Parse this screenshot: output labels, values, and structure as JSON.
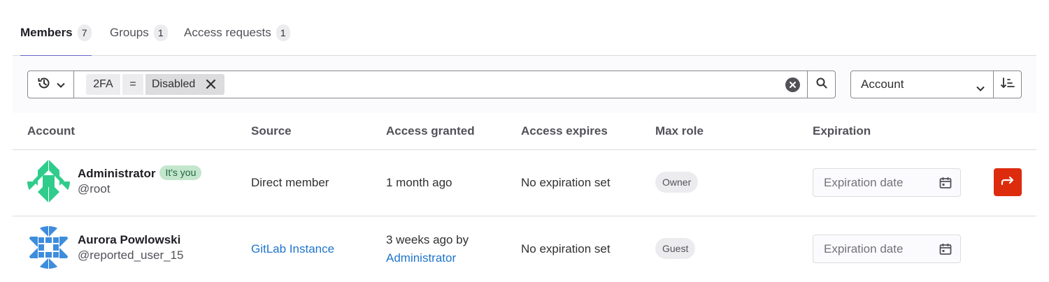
{
  "tabs": [
    {
      "label": "Members",
      "count": "7"
    },
    {
      "label": "Groups",
      "count": "1"
    },
    {
      "label": "Access requests",
      "count": "1"
    }
  ],
  "filter": {
    "tokens": [
      "2FA",
      "=",
      "Disabled"
    ],
    "sort_value": "Account"
  },
  "table": {
    "headers": [
      "Account",
      "Source",
      "Access granted",
      "Access expires",
      "Max role",
      "Expiration"
    ],
    "rows": [
      {
        "name": "Administrator",
        "badge": "It's you",
        "handle": "@root",
        "source": "Direct member",
        "access_granted": "1 month ago",
        "access_expires": "No expiration set",
        "max_role": "Owner",
        "expiration_placeholder": "Expiration date"
      },
      {
        "name": "Aurora Powlowski",
        "handle": "@reported_user_15",
        "source": "GitLab Instance",
        "access_granted": "3 weeks ago by",
        "granted_by": "Administrator",
        "access_expires": "No expiration set",
        "max_role": "Guest",
        "expiration_placeholder": "Expiration date"
      }
    ]
  },
  "colors": {
    "tab_underline": "#6666c4",
    "link": "#1f75cb",
    "danger": "#dd2b0e",
    "you_badge_bg": "#c3e6cd",
    "avatar1": "#2fcc8b",
    "avatar2": "#3e8ddd"
  },
  "icons": [
    "history-icon",
    "chevron-down-icon",
    "close-icon",
    "clear-icon",
    "search-icon",
    "sort-lowest-icon",
    "calendar-icon",
    "remove-member-icon"
  ]
}
